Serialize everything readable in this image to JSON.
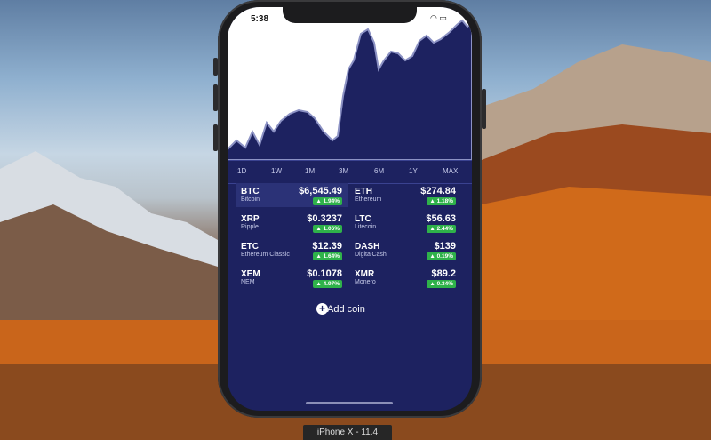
{
  "status_bar": {
    "time": "5:38",
    "icons": "••• ■"
  },
  "chart_ranges": [
    "1D",
    "1W",
    "1M",
    "3M",
    "6M",
    "1Y",
    "MAX"
  ],
  "coins": [
    {
      "symbol": "BTC",
      "name": "Bitcoin",
      "price": "$6,545.49",
      "change": "▲ 1.94%"
    },
    {
      "symbol": "ETH",
      "name": "Ethereum",
      "price": "$274.84",
      "change": "▲ 1.18%"
    },
    {
      "symbol": "XRP",
      "name": "Ripple",
      "price": "$0.3237",
      "change": "▲ 1.06%"
    },
    {
      "symbol": "LTC",
      "name": "Litecoin",
      "price": "$56.63",
      "change": "▲ 2.44%"
    },
    {
      "symbol": "ETC",
      "name": "Ethereum Classic",
      "price": "$12.39",
      "change": "▲ 1.64%"
    },
    {
      "symbol": "DASH",
      "name": "DigitalCash",
      "price": "$139",
      "change": "▲ 0.19%"
    },
    {
      "symbol": "XEM",
      "name": "NEM",
      "price": "$0.1078",
      "change": "▲ 4.97%"
    },
    {
      "symbol": "XMR",
      "name": "Monero",
      "price": "$89.2",
      "change": "▲ 0.34%"
    }
  ],
  "add_coin_label": "Add coin",
  "device_label": "iPhone X - 11.4",
  "colors": {
    "screen_bg": "#1d2260",
    "positive": "#2fb24a"
  }
}
